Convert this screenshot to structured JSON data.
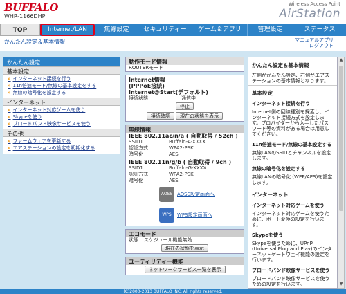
{
  "header": {
    "brand": "BUFFALO",
    "model": "WHR-1166DHP",
    "subtitle": "Wireless Access Point",
    "product": "AirStation"
  },
  "tabs": [
    {
      "label": "TOP"
    },
    {
      "label": "Internet/LAN"
    },
    {
      "label": "無線設定"
    },
    {
      "label": "セキュリティー"
    },
    {
      "label": "ゲーム＆アプリ"
    },
    {
      "label": "管理設定"
    },
    {
      "label": "ステータス"
    }
  ],
  "breadcrumb": "かんたん設定＆基本情報",
  "manual": {
    "line1": "マニュアルアプリ",
    "line2": "ログアウト"
  },
  "left": {
    "title": "かんたん設定",
    "sections": [
      {
        "title": "基本設定",
        "items": [
          "インターネット接続を行う",
          "11n倍速モード/無線の基本設定をする",
          "無線の暗号化を設定する"
        ]
      },
      {
        "title": "インターネット",
        "items": [
          "インターネット対応ゲームを使う",
          "Skypeを使う",
          "ブロードバンド映像サービスを使う"
        ]
      },
      {
        "title": "その他",
        "items": [
          "ファームウェアを更新する",
          "エアステーションの設定を初期化する"
        ]
      }
    ]
  },
  "mode": {
    "title": "動作モード情報",
    "value": "ROUTERモード"
  },
  "internet": {
    "title": "Internet情報",
    "type": "(PPPoE接続)",
    "account": "Internet@Start(デフォルト)",
    "status_label": "接続状態",
    "status_value": "通信中",
    "stop_btn": "停止",
    "check_btn": "接続確認",
    "show_btn": "現在の状態を表示"
  },
  "wireless": {
    "title": "無線情報",
    "band1": "IEEE 802.11ac/n/a ( 自動取得 / 52ch )",
    "band1_rows": [
      {
        "k": "SSID1",
        "v": "Buffalo-A-XXXX"
      },
      {
        "k": "認証方式",
        "v": "WPA2-PSK"
      },
      {
        "k": "暗号化",
        "v": "AES"
      }
    ],
    "band2": "IEEE 802.11n/g/b ( 自動取得 / 9ch )",
    "band2_rows": [
      {
        "k": "SSID1",
        "v": "Buffalo-G-XXXX"
      },
      {
        "k": "認証方式",
        "v": "WPA2-PSK"
      },
      {
        "k": "暗号化",
        "v": "AES"
      }
    ],
    "aoss_link": "AOSS設定画面へ",
    "aoss_icon": "AOSS",
    "wps_link": "WPS設定画面へ",
    "wps_icon": "WPS"
  },
  "eco": {
    "title": "エコモード",
    "k": "状態",
    "v": "スケジュール機能無効",
    "btn": "現在の状態を表示"
  },
  "utility": {
    "title": "ユーティリティー機能",
    "btn": "ネットワークサービス一覧を表示"
  },
  "help": {
    "title": "かんたん設定＆基本情報",
    "intro": "左側がかんたん設定、右側がエアステーションの基本情報となります。",
    "h_basic": "基本設定",
    "s_inet": "インターネット接続を行う",
    "p_inet": "Internet側の回線種別を探索し、インターネット接続方式を設定します。プロバイダーから入手したパスワード等の資料がある場合は用意してください。",
    "s_11n": "11n倍速モード/無線の基本設定する",
    "p_11n": "無線LANのSSIDとチャンネルを設定します。",
    "s_enc": "無線の暗号化を設定する",
    "p_enc": "無線LANの暗号化 (WEP/AES)を設定します。",
    "h_net": "インターネット",
    "s_game": "インターネット対応ゲームを使う",
    "p_game": "インターネット対応ゲームを使うために、ポート変換の設定を行います。",
    "s_skype": "Skypeを使う",
    "p_skype": "Skypeを使うために、UPnP (Universal Plug and Play)のインターネットゲートウェイ機能の設定を行います。",
    "s_bb": "ブロードバンド映像サービスを使う",
    "p_bb": "ブロードバンド映像サービスを使うための設定を行います。"
  },
  "footer": "(C)2000-2013 BUFFALO INC. All rights reserved."
}
